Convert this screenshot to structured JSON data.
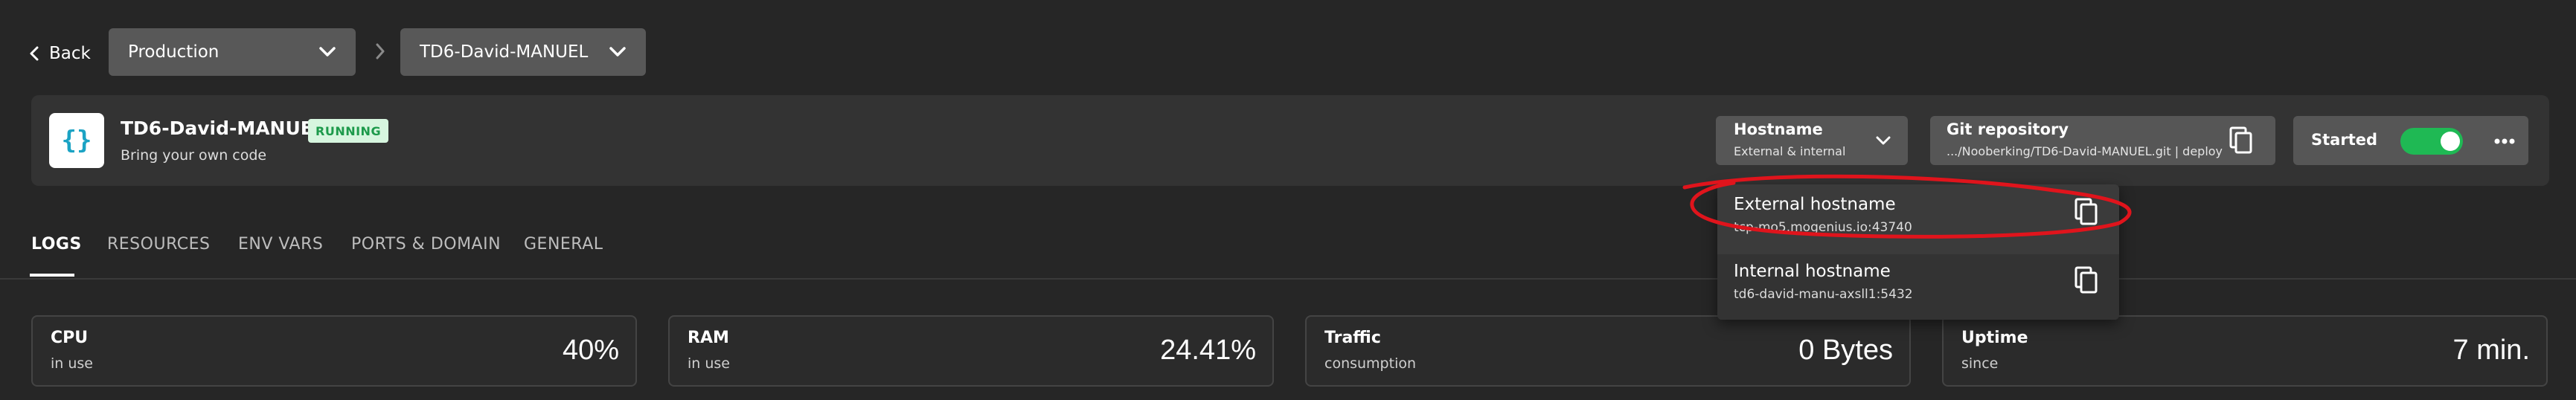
{
  "nav": {
    "back_label": "Back",
    "environment_select": "Production",
    "service_select": "TD6-David-MANUEL"
  },
  "service": {
    "name": "TD6-David-MANUEL",
    "status": "RUNNING",
    "subtitle": "Bring your own code",
    "logo_text": "{}",
    "hostname": {
      "title": "Hostname",
      "subtitle": "External & internal"
    },
    "git": {
      "title": "Git repository",
      "subtitle": ".../Nooberking/TD6-David-MANUEL.git | deploy"
    },
    "state": {
      "label": "Started",
      "on": true
    }
  },
  "tabs": [
    {
      "label": "LOGS",
      "active": true
    },
    {
      "label": "RESOURCES",
      "active": false
    },
    {
      "label": "ENV VARS",
      "active": false
    },
    {
      "label": "PORTS & DOMAIN",
      "active": false
    },
    {
      "label": "GENERAL",
      "active": false
    }
  ],
  "metrics": [
    {
      "title": "CPU",
      "subtitle": "in use",
      "value": "40%"
    },
    {
      "title": "RAM",
      "subtitle": "in use",
      "value": "24.41%"
    },
    {
      "title": "Traffic",
      "subtitle": "consumption",
      "value": "0 Bytes"
    },
    {
      "title": "Uptime",
      "subtitle": "since",
      "value": "7 min."
    }
  ],
  "hostname_popup": {
    "external": {
      "title": "External hostname",
      "value": "tcp-mo5.mogenius.io:43740"
    },
    "internal": {
      "title": "Internal hostname",
      "value": "td6-david-manu-axsll1:5432"
    }
  },
  "colors": {
    "background": "#262626",
    "accent_green": "#1fb954",
    "badge_bg": "#d7f6df",
    "badge_text": "#1d9a4b",
    "logo_blue": "#1ba3c4",
    "annotation_red": "#e0141c"
  },
  "icons": [
    "chevron-left-icon",
    "chevron-down-icon",
    "chevron-right-icon",
    "copy-icon",
    "more-dots-icon"
  ]
}
